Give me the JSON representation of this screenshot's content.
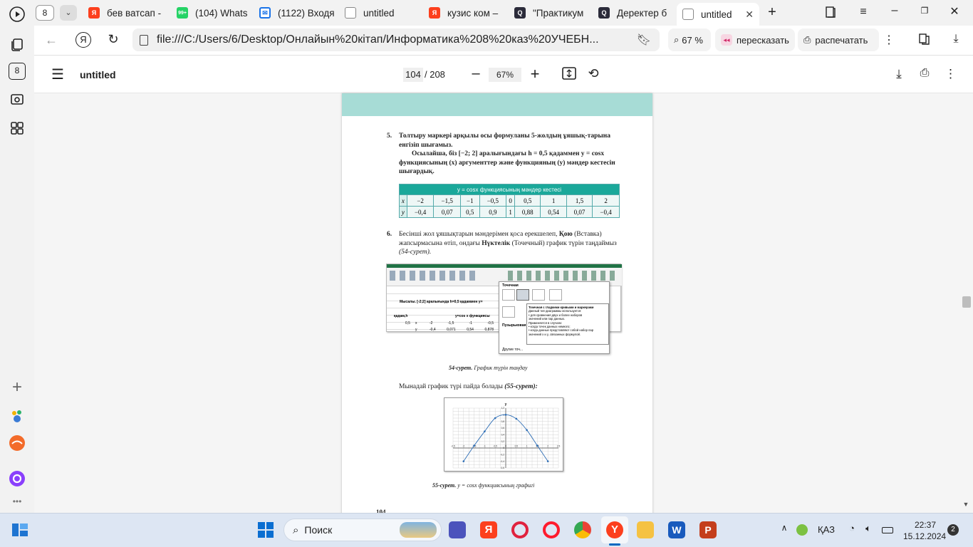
{
  "left_panel": {
    "counter": "8"
  },
  "tabs": [
    {
      "label": "бев ватсап -",
      "favicon": "yandex"
    },
    {
      "label": "(104) Whats",
      "favicon": "whatsapp",
      "badge": "99+"
    },
    {
      "label": "(1122) Входя",
      "favicon": "mail"
    },
    {
      "label": "untitled",
      "favicon": "file"
    },
    {
      "label": "кузис ком –",
      "favicon": "yandex"
    },
    {
      "label": "\"Практикум",
      "favicon": "q"
    },
    {
      "label": "Деректер б",
      "favicon": "q"
    },
    {
      "label": "untitled",
      "favicon": "file",
      "active": true
    }
  ],
  "tab_counter": "8",
  "address": {
    "url": "file:///C:/Users/6/Desktop/Онлайын%20кітап/Информатика%208%20каз%20УЧЕБН...",
    "zoom": "67 %",
    "retell": "пересказать",
    "print": "распечатать"
  },
  "pdf_toolbar": {
    "title": "untitled",
    "page_current": "104",
    "page_total": "/ 208",
    "zoom": "67%"
  },
  "page": {
    "item5_num": "5.",
    "item5_text": "Толтыру маркері арқылы осы формуланы 5-жолдың ұяшық-тарына енгізіп шығамыз.",
    "item5_para": "Осылайша, біз [−2; 2] аралығындағы h = 0,5 қадаммен y = cosx функциясының (x) аргументтер және функцияның (y) мәндер кестесін шығардық.",
    "table_title": "y = cosx функциясының мәндер кестесі",
    "table_x_label": "x",
    "table_y_label": "y",
    "table_x": [
      "−2",
      "−1,5",
      "−1",
      "−0,5",
      "0",
      "0,5",
      "1",
      "1,5",
      "2"
    ],
    "table_y": [
      "−0,4",
      "0,07",
      "0,5",
      "0,9",
      "1",
      "0,88",
      "0,54",
      "0,07",
      "−0,4"
    ],
    "item6_num": "6.",
    "item6_text_a": "Бесінші жол ұяшықтарын мәндерімен қоса ерекшелеп, ",
    "item6_bold1": "Қою",
    "item6_text_b": " (Вставка) жапсырмасына өтіп, ондағы ",
    "item6_bold2": "Нүктелік",
    "item6_text_c": " (Точечный) график түрін таңдаймыз ",
    "item6_ref": "(54-сурет).",
    "fig54_caption_bold": "54-сурет.",
    "fig54_caption": " График түрін таңдау",
    "fig54_row1": "Мысалы. [-2;2] аралығында h=0,5 қадаммен y=",
    "fig54_step": "қадам,h",
    "fig54_fn": "y=cos x функциясы",
    "fig54_h": "0,5",
    "fig54_x": "x",
    "fig54_y": "y",
    "fig54_xvals": [
      "-2",
      "-1,5",
      "-1",
      "-0,5"
    ],
    "fig54_yvals": [
      "-0,4",
      "0,071",
      "0,54",
      "0,878"
    ],
    "fig54_popup_title": "Точечная",
    "fig54_popup_sub": "Пузырьковая",
    "fig54_popup_more": "Другие точ...",
    "fig54_tooltip_title": "Точечная с гладкими кривыми и маркерами",
    "fig54_tooltip_l1": "Данный тип диаграммы используется:",
    "fig54_tooltip_l2": "• для сравнения двух и более наборов",
    "fig54_tooltip_l3": "значений или пар данных.",
    "fig54_tooltip_l4": "Применяется в случаях:",
    "fig54_tooltip_l5": "• когда точек данных немного;",
    "fig54_tooltip_l6": "• когда данные представляют собой набор пар",
    "fig54_tooltip_l7": "значений x и y, связанных формулой.",
    "line55": "Мынадай график түрі пайда болады ",
    "line55_ref": "(55-сурет):",
    "fig55_caption_bold": "55-сурет.",
    "fig55_caption": " y = cosx функциясының графигі",
    "page_number": "104"
  },
  "chart_data": {
    "type": "scatter",
    "title": "y",
    "x": [
      -2,
      -1.5,
      -1,
      -0.5,
      0,
      0.5,
      1,
      1.5,
      2
    ],
    "y": [
      -0.4,
      0.07,
      0.5,
      0.9,
      1,
      0.88,
      0.54,
      0.07,
      -0.4
    ],
    "xlim": [
      -2.5,
      2.5
    ],
    "ylim": [
      -0.6,
      1.2
    ],
    "xticks": [
      "-2,5",
      "-2",
      "-1,5",
      "-1",
      "-0,5",
      "0",
      "0,5",
      "1",
      "1,5",
      "2",
      "2,5"
    ],
    "yticks": [
      "1,2",
      "1",
      "0,8",
      "0,6",
      "0,4",
      "0,2",
      "0",
      "-0,2",
      "-0,4",
      "-0,6"
    ],
    "grid": true,
    "series_color": "#2d6db5"
  },
  "taskbar": {
    "search": "Поиск",
    "lang": "ҚАЗ",
    "time": "22:37",
    "date": "15.12.2024",
    "notif": "2"
  }
}
